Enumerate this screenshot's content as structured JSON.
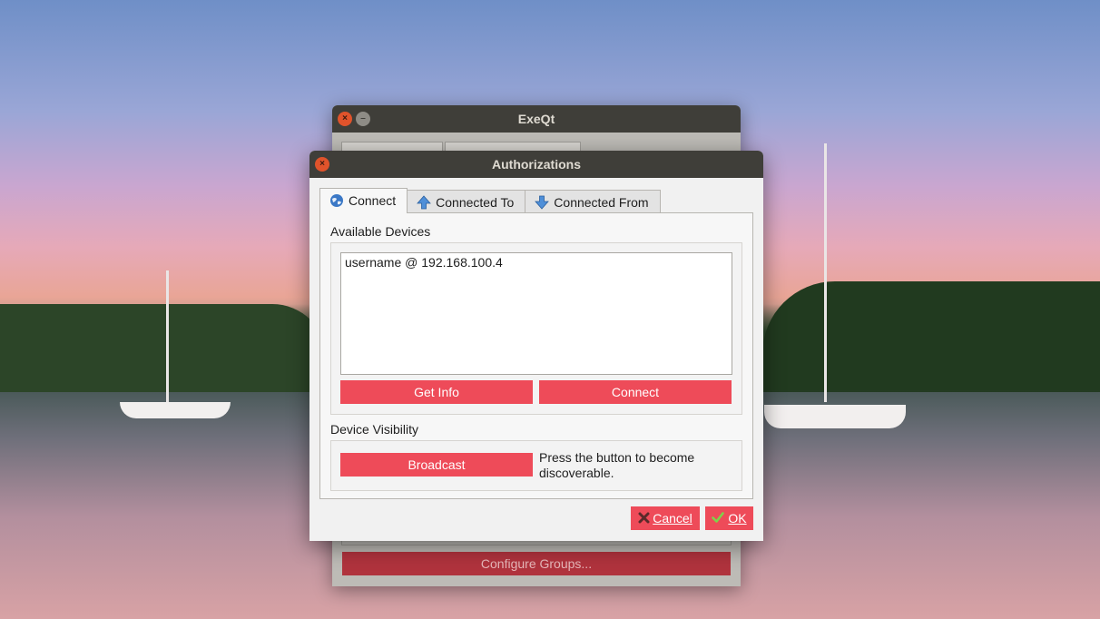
{
  "background_window": {
    "title": "ExeQt",
    "close_glyph": "×",
    "minimize_glyph": "–",
    "configure_groups_label": "Configure Groups..."
  },
  "dialog": {
    "title": "Authorizations",
    "close_glyph": "×",
    "tabs": [
      {
        "label": "Connect",
        "icon": "globe-icon",
        "active": true
      },
      {
        "label": "Connected To",
        "icon": "arrow-up-icon",
        "active": false
      },
      {
        "label": "Connected From",
        "icon": "arrow-down-icon",
        "active": false
      }
    ],
    "available_devices": {
      "heading": "Available Devices",
      "items": [
        "username @ 192.168.100.4"
      ],
      "get_info_label": "Get Info",
      "connect_label": "Connect"
    },
    "device_visibility": {
      "heading": "Device Visibility",
      "broadcast_label": "Broadcast",
      "hint": "Press the button to become discoverable."
    },
    "cancel_label": "Cancel",
    "ok_label": "OK"
  },
  "colors": {
    "accent_red": "#ee4b59",
    "titlebar": "#3f3e39",
    "close_button": "#e0532b"
  }
}
